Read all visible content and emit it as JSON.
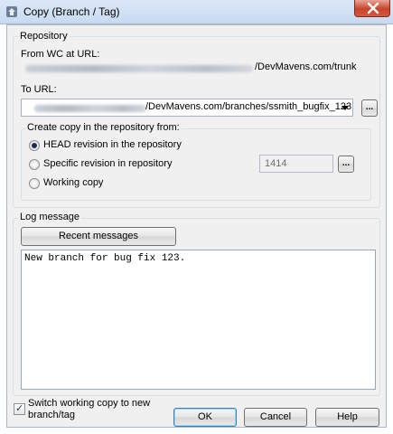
{
  "window": {
    "title": "Copy (Branch / Tag)"
  },
  "repository": {
    "group_label": "Repository",
    "from_label": "From WC at URL:",
    "from_url_visible": "/DevMavens.com/trunk",
    "to_label": "To URL:",
    "to_url_visible": "/DevMavens.com/branches/ssmith_bugfix_123",
    "browse_label": "..."
  },
  "copy_from": {
    "group_label": "Create copy in the repository from:",
    "options": [
      {
        "label": "HEAD revision in the repository",
        "checked": true
      },
      {
        "label": "Specific revision in repository",
        "checked": false
      },
      {
        "label": "Working copy",
        "checked": false
      }
    ],
    "revision_value": "1414",
    "browse_label": "..."
  },
  "log": {
    "group_label": "Log message",
    "recent_button": "Recent messages",
    "message": "New branch for bug fix 123."
  },
  "footer": {
    "switch_label_line1": "Switch working copy to new",
    "switch_label_line2": "branch/tag",
    "switch_checked": true,
    "ok_label": "OK",
    "cancel_label": "Cancel",
    "help_label": "Help"
  },
  "icons": {
    "title": "tortoisesvn-copy-icon",
    "close": "close-icon",
    "dropdown": "chevron-down-icon",
    "check": "checkmark-icon"
  }
}
